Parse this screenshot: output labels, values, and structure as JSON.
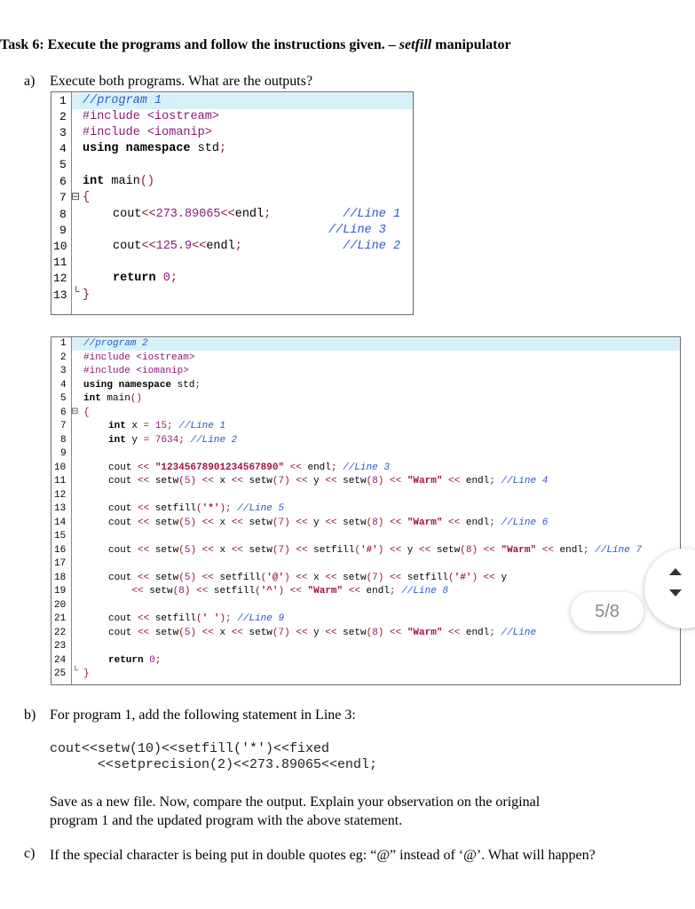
{
  "title": {
    "bold": "Task 6: Execute the programs and follow the instructions given. – ",
    "italic": "setfill",
    "rest": " manipulator"
  },
  "question_a": {
    "label": "a)",
    "text": "Execute both programs. What are the outputs?"
  },
  "program1": {
    "line_numbers": [
      "1",
      "2",
      "3",
      "4",
      "5",
      "6",
      "7",
      "8",
      "9",
      "10",
      "11",
      "12",
      "13"
    ]
  },
  "program2": {
    "line_numbers": [
      "1",
      "2",
      "3",
      "4",
      "5",
      "6",
      "7",
      "8",
      "9",
      "10",
      "11",
      "12",
      "13",
      "14",
      "15",
      "16",
      "17",
      "18",
      "19",
      "20",
      "21",
      "22",
      "23",
      "24",
      "25"
    ]
  },
  "page_indicator": "5/8",
  "question_b": {
    "label": "b)",
    "text": "For program 1, add the following statement in Line 3:",
    "code_line1": "cout<<setw(10)<<setfill('*')<<fixed",
    "code_line2": "<<setprecision(2)<<273.89065<<endl;",
    "para": "Save as a new file. Now, compare the output. Explain your observation on the original program 1 and the updated program with the above statement."
  },
  "question_c": {
    "label": "c)",
    "text": "If the special character is being put in double quotes eg: “@” instead of ‘@’. What will happen?"
  }
}
